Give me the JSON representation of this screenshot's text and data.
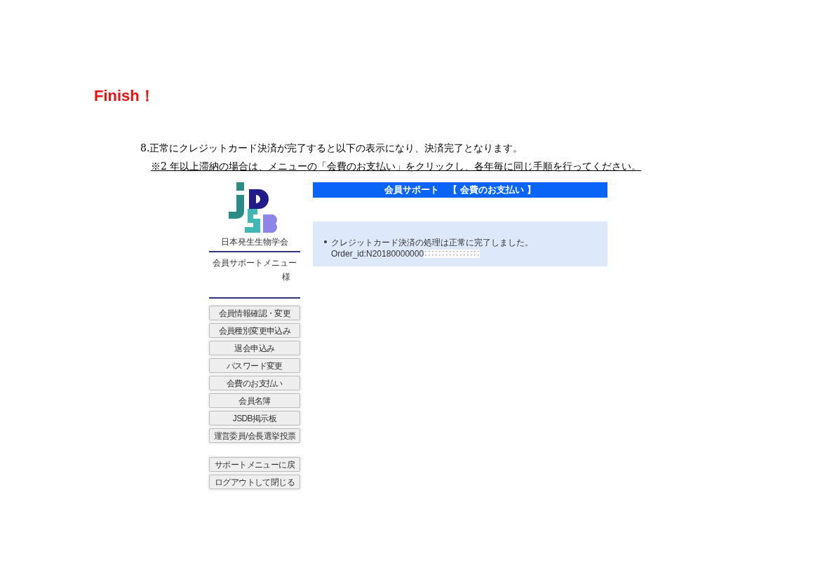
{
  "heading": "Finish！",
  "instructions": [
    "8.正常にクレジットカード決済が完了すると以下の表示になり、決済完了となります。",
    "※2 年以上滞納の場合は、メニューの「会費のお支払い」をクリックし、各年毎に同じ手順を行ってください。"
  ],
  "screenshot": {
    "sidebar": {
      "org_name": "日本発生生物学会",
      "menu_title": "会員サポートメニュー",
      "user_suffix": "様",
      "menu_buttons": [
        "会員情報確認・変更",
        "会員種別変更申込み",
        "退会申込み",
        "パスワード変更",
        "会費のお支払い",
        "会員名簿",
        "JSDB掲示板",
        "運営委員/会長選挙投票"
      ],
      "bottom_buttons": [
        "サポートメニューに戻",
        "ログアウトして閉じる"
      ]
    },
    "main": {
      "title": "会員サポート　【 会費のお支払い 】",
      "message": "クレジットカード決済の処理は正常に完了しました。",
      "order_id": "Order_id:N20180000000"
    }
  }
}
